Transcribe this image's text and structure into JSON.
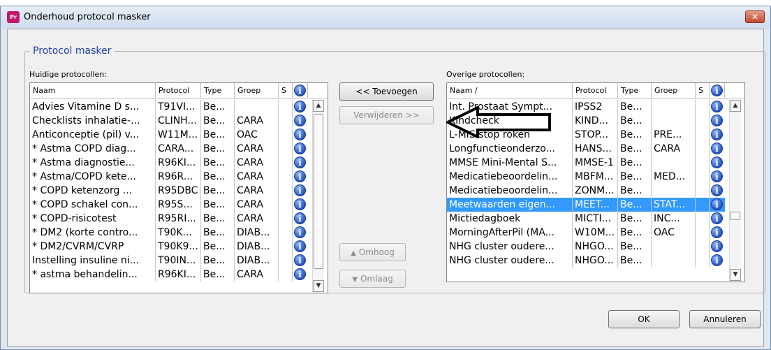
{
  "window": {
    "title": "Onderhoud protocol masker",
    "app_icon_text": "Pr",
    "close_symbol": "✕"
  },
  "group": {
    "legend": "Protocol masker"
  },
  "left": {
    "label": "Huidige protocollen:",
    "columns": [
      "Naam",
      "Protocol",
      "Type",
      "Groep",
      "S",
      "i"
    ],
    "rows": [
      [
        "Advies Vitamine D s...",
        "T91VI...",
        "Be...",
        ""
      ],
      [
        "Checklists inhalatie-...",
        "CLINH...",
        "Be...",
        "CARA"
      ],
      [
        "Anticonceptie (pil) v...",
        "W11M...",
        "Be...",
        "OAC"
      ],
      [
        "* Astma COPD diag...",
        "CARA...",
        "Be...",
        "CARA"
      ],
      [
        "* Astma diagnostie...",
        "R96KI...",
        "Be...",
        "CARA"
      ],
      [
        "* Astma/COPD kete...",
        "R96R...",
        "Be...",
        "CARA"
      ],
      [
        "* COPD ketenzorg ...",
        "R95DBC",
        "Be...",
        "CARA"
      ],
      [
        "* COPD schakel con...",
        "R95S...",
        "Be...",
        "CARA"
      ],
      [
        "* COPD-risicotest",
        "R95RI...",
        "Be...",
        "CARA"
      ],
      [
        "* DM2 (korte contro...",
        "T90K...",
        "Be...",
        "DIAB..."
      ],
      [
        "* DM2/CVRM/CVRP",
        "T90K9...",
        "Be...",
        "DIAB..."
      ],
      [
        "Instelling insuline ni...",
        "T90IN...",
        "Be...",
        "DIAB..."
      ],
      [
        "* astma behandelin...",
        "R96KI...",
        "Be...",
        "CARA"
      ]
    ]
  },
  "right": {
    "label": "Overige protocollen:",
    "columns": [
      "Naam /",
      "Protocol",
      "Type",
      "Groep",
      "S",
      "i"
    ],
    "rows": [
      [
        "Int. Prostaat Sympt...",
        "IPSS2",
        "Be...",
        ""
      ],
      [
        "Kindcheck",
        "KIND...",
        "Be...",
        ""
      ],
      [
        "L-MIS stop roken",
        "STOP...",
        "Be...",
        "PRE..."
      ],
      [
        "Longfunctieonderzo...",
        "HANS...",
        "Be...",
        "CARA"
      ],
      [
        "MMSE Mini-Mental S...",
        "MMSE-1",
        "Be...",
        ""
      ],
      [
        "Medicatiebeoordelin...",
        "MBFM...",
        "Be...",
        "MED..."
      ],
      [
        "Medicatiebeoordelin...",
        "ZONM...",
        "Be...",
        ""
      ],
      [
        "Meetwaarden eigen...",
        "MEET...",
        "Be...",
        "STAT..."
      ],
      [
        "Mictiedagboek",
        "MICTI...",
        "Be...",
        "INC..."
      ],
      [
        "MorningAfterPil (MA...",
        "W10M...",
        "Be...",
        "OAC"
      ],
      [
        "NHG cluster oudere...",
        "NHGO...",
        "Be...",
        ""
      ],
      [
        "NHG cluster oudere...",
        "NHGO...",
        "Be...",
        ""
      ]
    ],
    "selected_row": 7
  },
  "buttons": {
    "add": "<< Toevoegen",
    "remove": "Verwijderen >>",
    "up": "Omhoog",
    "down": "Omlaag",
    "ok": "OK",
    "cancel": "Annuleren"
  },
  "icons": {
    "info": "info-icon",
    "up_arrow": "up-arrow-icon",
    "down_arrow": "down-arrow-icon",
    "annotation_arrow": "left-arrow-annotation"
  },
  "colors": {
    "selection": "#3399ff",
    "legend_text": "#1f3fa8",
    "close_button": "#c24a33"
  }
}
